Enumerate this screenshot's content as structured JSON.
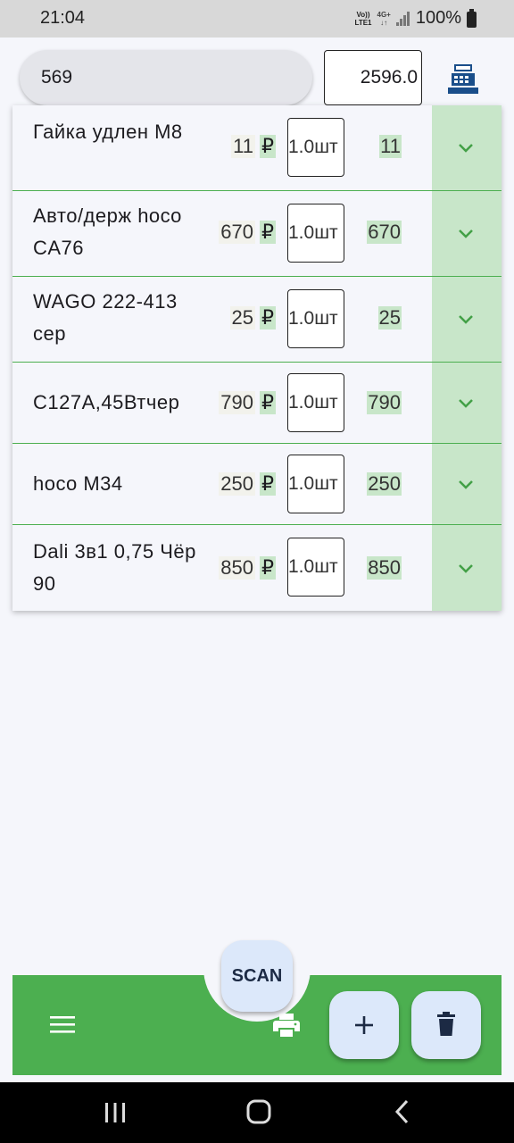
{
  "status_bar": {
    "time": "21:04",
    "network_top": "Vo))",
    "network_bottom": "LTE1",
    "network_type": "4G+",
    "battery": "100%"
  },
  "header": {
    "search_value": "569",
    "total_value": "2596.0",
    "register_icon": "cash-register-icon"
  },
  "items": [
    {
      "name": "Гайка удлен М8",
      "price": "11",
      "currency": "₽",
      "qty": "1.0",
      "unit": "шт",
      "sum": "11"
    },
    {
      "name": "Авто/держ hoco CA76",
      "price": "670",
      "currency": "₽",
      "qty": "1.0",
      "unit": "шт",
      "sum": "670"
    },
    {
      "name": "WAGO 222-413 сер",
      "price": "25",
      "currency": "₽",
      "qty": "1.0",
      "unit": "шт",
      "sum": "25"
    },
    {
      "name": "C127A,45Втчер",
      "price": "790",
      "currency": "₽",
      "qty": "1.0",
      "unit": "шт",
      "sum": "790"
    },
    {
      "name": "hoco M34",
      "price": "250",
      "currency": "₽",
      "qty": "1.0",
      "unit": "шт",
      "sum": "250"
    },
    {
      "name": "Dali 3в1 0,75 Чёр 90",
      "price": "850",
      "currency": "₽",
      "qty": "1.0",
      "unit": "шт",
      "sum": "850"
    }
  ],
  "bottom_bar": {
    "scan_label": "SCAN",
    "menu_icon": "menu-icon",
    "print_icon": "print-icon",
    "add_icon": "plus-icon",
    "delete_icon": "trash-icon",
    "accent_color": "#4caf50",
    "fab_color": "#dce8fa"
  }
}
